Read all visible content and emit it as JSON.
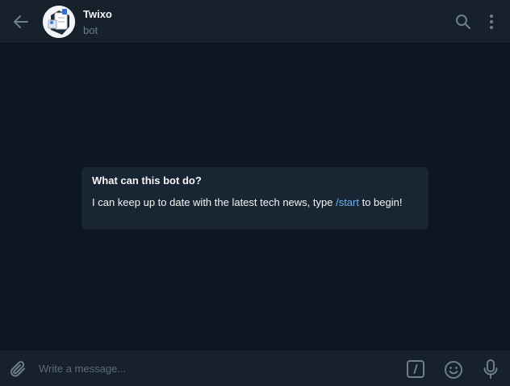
{
  "header": {
    "back_icon": "arrow-left-icon",
    "title": "Twixo",
    "subtitle": "bot",
    "search_icon": "search-icon",
    "more_icon": "more-vertical-icon"
  },
  "info_card": {
    "title": "What can this bot do?",
    "text_before": "I can keep up to date with the latest tech news, type ",
    "command": "/start",
    "text_after": " to begin!"
  },
  "composer": {
    "placeholder": "Write a message...",
    "value": "",
    "attach_icon": "paperclip-icon",
    "commands_icon": "slash-command-icon",
    "emoji_icon": "emoji-icon",
    "mic_icon": "microphone-icon"
  },
  "colors": {
    "background": "#0e1621",
    "header": "#17212b",
    "card": "#182533",
    "link": "#6ab3f3",
    "muted": "#6d7f8f"
  }
}
